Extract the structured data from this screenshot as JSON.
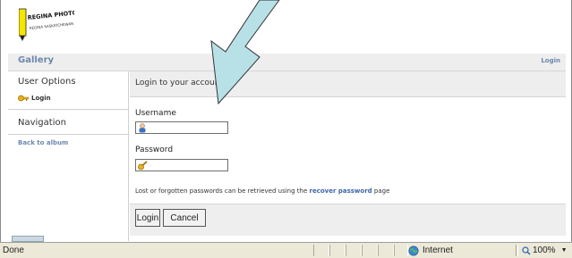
{
  "header": {
    "logo_text": "REGINA PHOTO CLUB",
    "logo_subtext": "REGINA SASKATCHEWAN",
    "gallery_label": "Gallery",
    "login_link": "Login"
  },
  "sidebar": {
    "user_options_heading": "User Options",
    "login_item": "Login",
    "navigation_heading": "Navigation",
    "back_link": "Back to album"
  },
  "main": {
    "heading": "Login to your account",
    "username_label": "Username",
    "username_value": "",
    "password_label": "Password",
    "password_value": "",
    "hint_before": "Lost or forgotten passwords can be retrieved using the ",
    "hint_link": "recover password",
    "hint_after": " page",
    "login_button": "Login",
    "cancel_button": "Cancel"
  },
  "statusbar": {
    "status": "Done",
    "zone": "Internet",
    "zoom": "100%"
  },
  "icons": {
    "key": "key-icon",
    "user": "user-icon",
    "globe": "globe-icon",
    "zoom": "magnifier-icon"
  },
  "colors": {
    "link": "#6d88ad",
    "panel": "#eeeeee",
    "arrow_fill": "#b7e1e7",
    "logo_yellow": "#f6e600"
  }
}
